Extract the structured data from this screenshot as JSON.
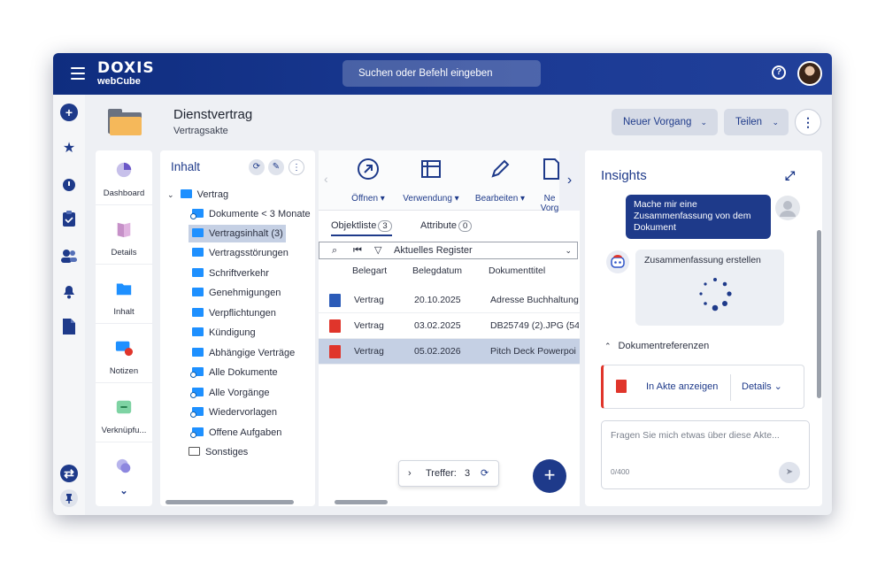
{
  "app": {
    "logo_line1": "DOXIS",
    "logo_line2": "webCube"
  },
  "search": {
    "placeholder": "Suchen oder Befehl eingeben"
  },
  "header": {
    "title": "Dienstvertrag",
    "subtitle": "Vertragsakte",
    "new_case_label": "Neuer Vorgang",
    "share_label": "Teilen"
  },
  "nav": {
    "items": [
      {
        "label": "Dashboard"
      },
      {
        "label": "Details"
      },
      {
        "label": "Inhalt"
      },
      {
        "label": "Notizen",
        "badge": "0"
      },
      {
        "label": "Verknüpfu..."
      }
    ]
  },
  "tree": {
    "title": "Inhalt",
    "root": "Vertrag",
    "items": [
      "Dokumente < 3 Monate",
      "Vertragsinhalt (3)",
      "Vertragsstörungen",
      "Schriftverkehr",
      "Genehmigungen",
      "Verpflichtungen",
      "Kündigung",
      "Abhängige Verträge",
      "Alle Dokumente",
      "Alle Vorgänge",
      "Wiedervorlagen",
      "Offene Aufgaben",
      "Sonstiges"
    ]
  },
  "ribbon": {
    "open": "Öffnen",
    "usage": "Verwendung",
    "edit": "Bearbeiten",
    "new": "Ne Vorg"
  },
  "list": {
    "tab_objects": "Objektliste",
    "tab_objects_count": "3",
    "tab_attributes": "Attribute",
    "tab_attributes_count": "0",
    "register": "Aktuelles Register",
    "columns": [
      "Belegart",
      "Belegdatum",
      "Dokumenttitel"
    ],
    "rows": [
      {
        "type": "Vertrag",
        "date": "20.10.2025",
        "title": "Adresse Buchhaltung",
        "icon": "word"
      },
      {
        "type": "Vertrag",
        "date": "03.02.2025",
        "title": "DB25749 (2).JPG (54",
        "icon": "pdf"
      },
      {
        "type": "Vertrag",
        "date": "05.02.2026",
        "title": "Pitch Deck Powerpoi",
        "icon": "pdf"
      }
    ],
    "hits_label": "Treffer:",
    "hits_count": "3"
  },
  "insights": {
    "title": "Insights",
    "user_message": "Mache mir eine Zusammenfassung von dem Dokument",
    "bot_message": "Zusammenfassung erstellen",
    "refs_title": "Dokumentreferenzen",
    "ref_open": "In Akte anzeigen",
    "ref_details": "Details",
    "input_placeholder": "Fragen Sie mich etwas über diese Akte...",
    "char_count": "0/400"
  },
  "colors": {
    "primary": "#1e3a8a",
    "selection": "#c5d0e4",
    "folder": "#1e90ff",
    "pdf": "#e0352b",
    "word": "#2b5bb8"
  }
}
